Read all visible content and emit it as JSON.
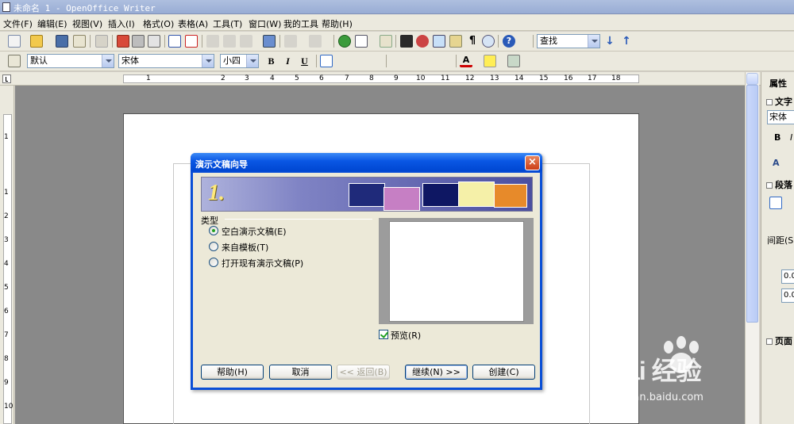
{
  "window": {
    "title": "未命名 1 - OpenOffice Writer"
  },
  "menu": [
    "文件(F)",
    "编辑(E)",
    "视图(V)",
    "插入(I)",
    "格式(O)",
    "表格(A)",
    "工具(T)",
    "窗口(W)",
    "我的工具",
    "帮助(H)"
  ],
  "toolbar": {
    "find_placeholder": "查找",
    "style": "默认",
    "font": "宋体",
    "size": "小四",
    "bold": "B",
    "italic": "I",
    "underline": "U"
  },
  "ruler": {
    "h_numbers": [
      "1",
      "2",
      "3",
      "4",
      "5",
      "6",
      "7",
      "8",
      "9",
      "10",
      "11",
      "12",
      "13",
      "14",
      "15",
      "16",
      "17",
      "18"
    ],
    "v_numbers": [
      "1",
      "1",
      "2",
      "3",
      "4",
      "5",
      "6",
      "7",
      "8",
      "9",
      "10"
    ]
  },
  "sidebar": {
    "title": "属性",
    "text_section": "文字",
    "font": "宋体",
    "bold": "B",
    "italic": "I",
    "paragraph_section": "段落",
    "spacing_label": "间距(S)",
    "spacing_value_1": "0.0",
    "spacing_value_2": "0.0",
    "page_section": "页面"
  },
  "dialog": {
    "title": "演示文稿向导",
    "close": "×",
    "step": "1.",
    "group_label": "类型",
    "options": [
      {
        "label": "空白演示文稿(E)",
        "selected": true
      },
      {
        "label": "来自模板(T)",
        "selected": false
      },
      {
        "label": "打开现有演示文稿(P)",
        "selected": false
      }
    ],
    "preview_label": "预览(R)",
    "preview_checked": true,
    "buttons": {
      "help": "帮助(H)",
      "cancel": "取消",
      "back": "<< 返回(B)",
      "next": "继续(N) >>",
      "create": "创建(C)"
    }
  },
  "watermark": {
    "brand": "Bai  经验",
    "url": "jingyan.baidu.com"
  }
}
